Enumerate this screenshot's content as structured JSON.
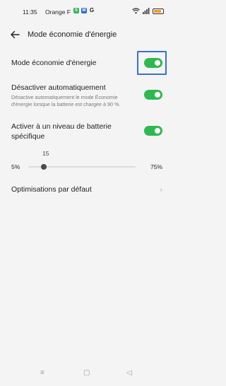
{
  "status": {
    "time": "11:35",
    "carrier": "Orange F",
    "app_icons": [
      {
        "name": "app-icon-green",
        "glyph": "S",
        "color": "#2eb950"
      },
      {
        "name": "app-icon-blue",
        "glyph": "M",
        "color": "#2f6bd6"
      },
      {
        "name": "google-icon",
        "glyph": "G",
        "color": "#222222"
      }
    ],
    "battery_level": 0.85,
    "battery_color": "#f0a020"
  },
  "header": {
    "title": "Mode économie d'énergie"
  },
  "settings": {
    "power_saving": {
      "label": "Mode économie d'énergie",
      "enabled": true
    },
    "auto_disable": {
      "label": "Désactiver automatiquement",
      "description": "Désactive automatiquement le mode Économie d'énergie lorsque la batterie est chargée à 90 %.",
      "enabled": true
    },
    "battery_level": {
      "label": "Activer à un niveau de batterie spécifique",
      "enabled": true,
      "slider": {
        "value": "15",
        "min_label": "5%",
        "max_label": "75%",
        "min": 5,
        "max": 75,
        "current": 15
      }
    },
    "default_optimizations": {
      "label": "Optimisations par défaut"
    }
  },
  "colors": {
    "accent": "#2eb950",
    "focus": "#3b6fd1"
  },
  "nav": {
    "menu": "≡",
    "home": "▢",
    "back": "◁"
  }
}
